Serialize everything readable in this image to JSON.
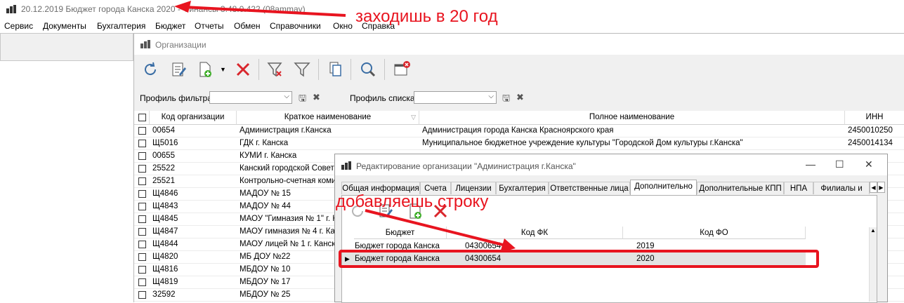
{
  "app": {
    "title": "20.12.2019 Бюджет города Канска 2020 - Финансы 3.48.0.422 (08ammav)"
  },
  "menu": [
    "Сервис",
    "Документы",
    "Бухгалтерия",
    "Бюджет",
    "Отчеты",
    "Обмен",
    "Справочники",
    "Окно",
    "Справка"
  ],
  "org_window": {
    "title": "Организации",
    "filter_profile_label": "Профиль фильтра",
    "list_profile_label": "Профиль списка",
    "columns": [
      "Код организации",
      "Краткое наименование",
      "Полное наименование",
      "ИНН"
    ],
    "rows": [
      {
        "code": "00654",
        "short": "Администрация г.Канска",
        "full": "Администрация города Канска Красноярского края",
        "inn": "2450010250"
      },
      {
        "code": "Щ5016",
        "short": "ГДК г. Канска",
        "full": "Муниципальное бюджетное учреждение культуры \"Городской Дом культуры г.Канска\"",
        "inn": "2450014134"
      },
      {
        "code": "00655",
        "short": "КУМИ г. Канска",
        "full": "",
        "inn": ""
      },
      {
        "code": "25522",
        "short": "Канский городской Совет д",
        "full": "",
        "inn": ""
      },
      {
        "code": "25521",
        "short": "Контрольно-счетная комис",
        "full": "",
        "inn": ""
      },
      {
        "code": "Щ4846",
        "short": "МАДОУ № 15",
        "full": "",
        "inn": ""
      },
      {
        "code": "Щ4843",
        "short": "МАДОУ № 44",
        "full": "",
        "inn": ""
      },
      {
        "code": "Щ4845",
        "short": "МАОУ \"Гимназия № 1\" г. К",
        "full": "",
        "inn": ""
      },
      {
        "code": "Щ4847",
        "short": "МАОУ гимназия № 4 г. Кан",
        "full": "",
        "inn": ""
      },
      {
        "code": "Щ4844",
        "short": "МАОУ лицей № 1 г. Канска",
        "full": "",
        "inn": ""
      },
      {
        "code": "Щ4820",
        "short": "МБ ДОУ №22",
        "full": "",
        "inn": ""
      },
      {
        "code": "Щ4816",
        "short": "МБДОУ № 10",
        "full": "",
        "inn": ""
      },
      {
        "code": "Щ4819",
        "short": "МБДОУ № 17",
        "full": "",
        "inn": ""
      },
      {
        "code": "З2592",
        "short": "МБДОУ № 25",
        "full": "",
        "inn": ""
      }
    ]
  },
  "edit_dialog": {
    "title": "Редактирование организации \"Администрация г.Канска\"",
    "tabs": [
      "Общая информация",
      "Счета",
      "Лицензии",
      "Бухгалтерия",
      "Ответственные лица",
      "Дополнительно",
      "Дополнительные КПП",
      "НПА",
      "Филиалы и"
    ],
    "active_tab": "Дополнительно",
    "columns": [
      "Бюджет",
      "Код ФК",
      "Код ФО"
    ],
    "rows": [
      {
        "budget": "Бюджет города Канска",
        "fk": "04300654",
        "fo": "2019"
      },
      {
        "budget": "Бюджет города Канска",
        "fk": "04300654",
        "fo": "2020"
      }
    ]
  },
  "annotations": {
    "top": "заходишь в 20 год",
    "middle": "добавляешь строку",
    "color": "#e8141f"
  }
}
